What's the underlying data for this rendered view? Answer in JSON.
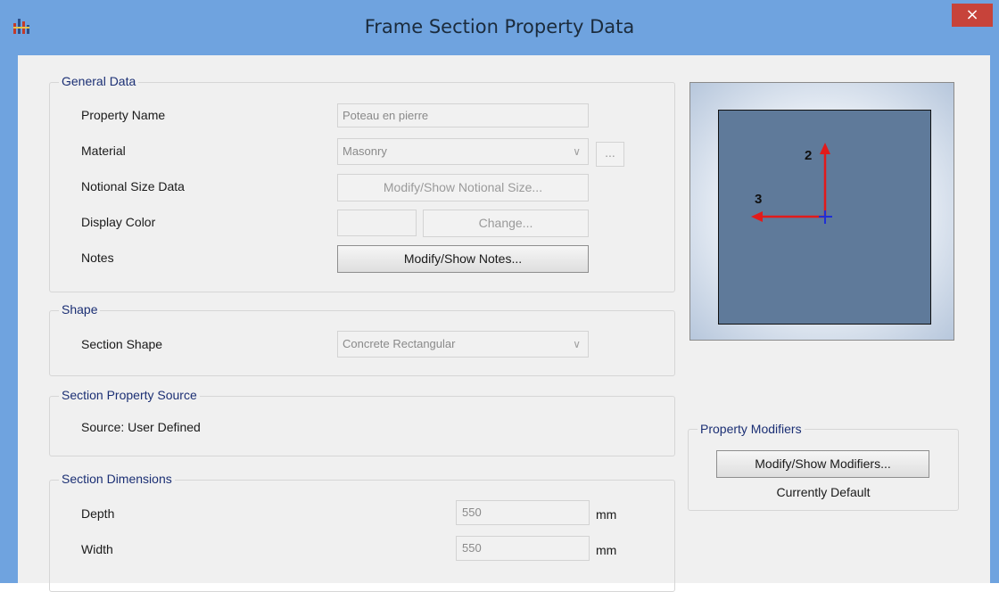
{
  "window": {
    "title": "Frame Section Property Data",
    "close_label": "×"
  },
  "general_data": {
    "group_label": "General Data",
    "property_name_label": "Property Name",
    "property_name_value": "Poteau en pierre",
    "material_label": "Material",
    "material_value": "Masonry",
    "material_more_label": "...",
    "notional_label": "Notional Size Data",
    "notional_button": "Modify/Show Notional Size...",
    "display_color_label": "Display Color",
    "change_button": "Change...",
    "notes_label": "Notes",
    "notes_button": "Modify/Show Notes..."
  },
  "shape": {
    "group_label": "Shape",
    "section_shape_label": "Section Shape",
    "section_shape_value": "Concrete Rectangular"
  },
  "source": {
    "group_label": "Section Property Source",
    "source_text": "Source:  User Defined"
  },
  "dimensions": {
    "group_label": "Section Dimensions",
    "depth_label": "Depth",
    "depth_value": "550",
    "depth_unit": "mm",
    "width_label": "Width",
    "width_value": "550",
    "width_unit": "mm"
  },
  "preview": {
    "axis_2_label": "2",
    "axis_3_label": "3"
  },
  "modifiers": {
    "group_label": "Property Modifiers",
    "button": "Modify/Show Modifiers...",
    "status": "Currently Default"
  },
  "colors": {
    "titlebar": "#6fa3df",
    "close": "#c7433a",
    "section_fill": "#5f7a9a",
    "axis_red": "#e21b1b",
    "axis_blue": "#1f2fd6",
    "group_title": "#1b2f74"
  }
}
